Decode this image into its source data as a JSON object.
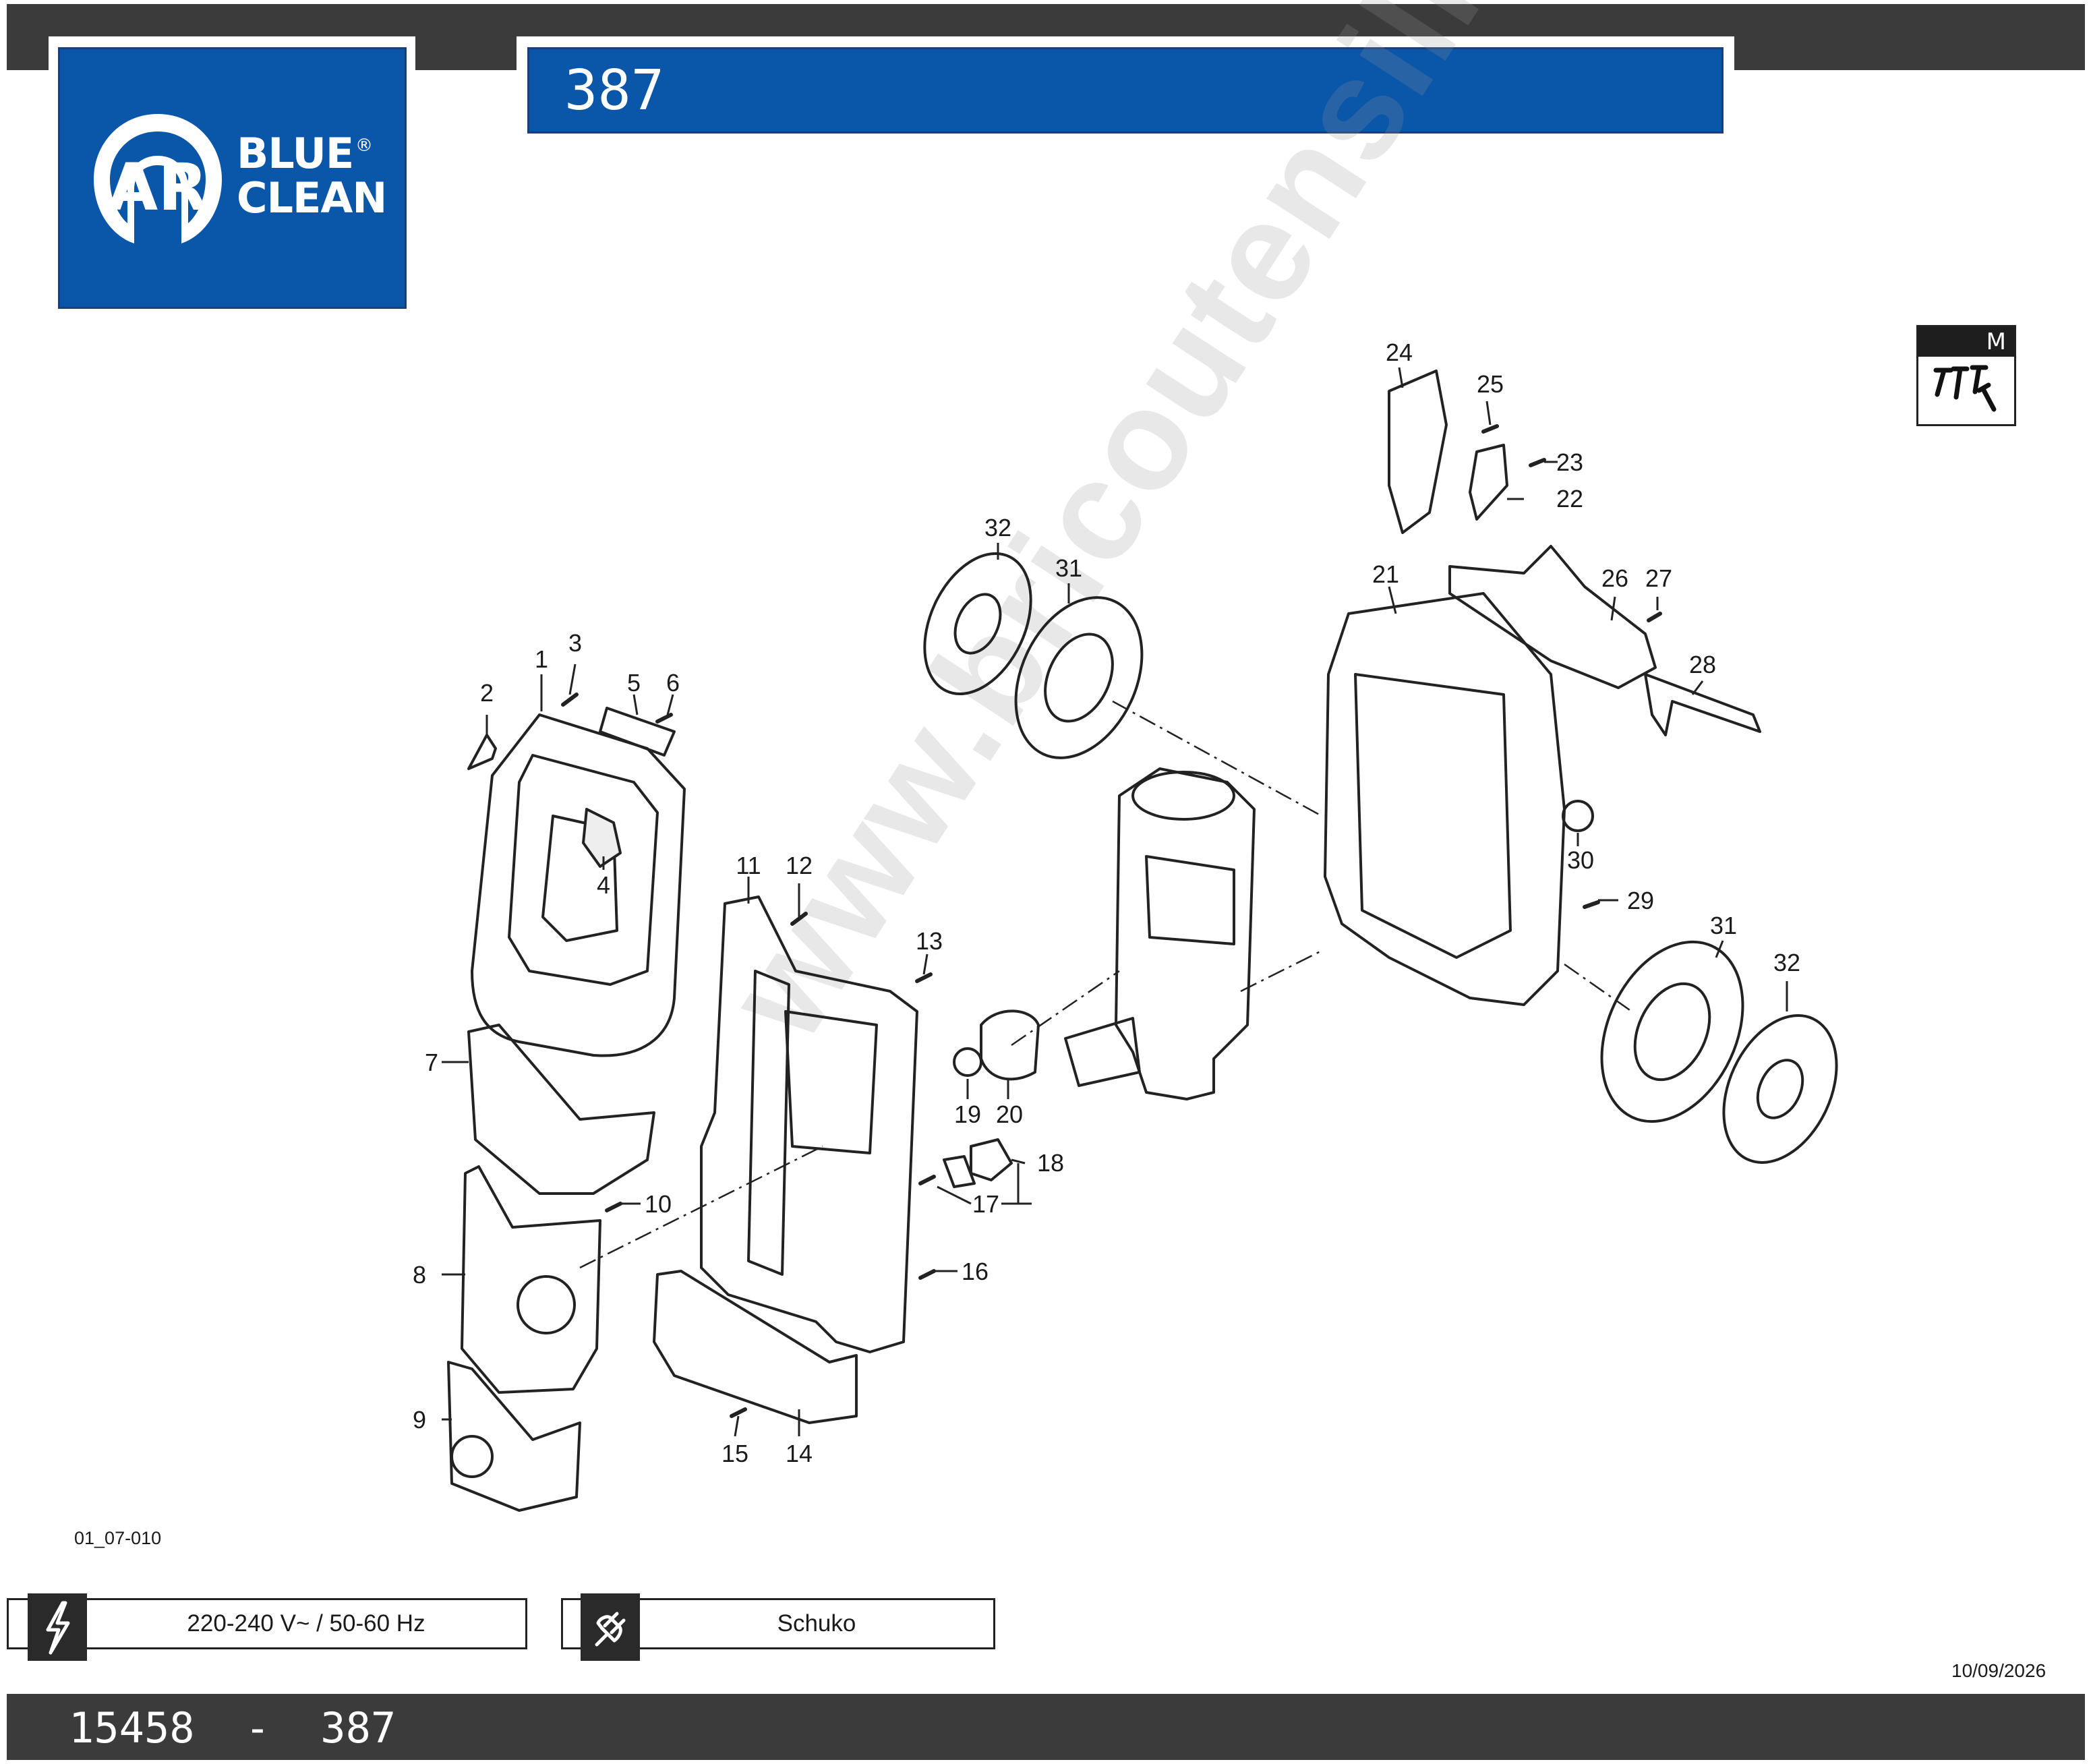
{
  "header": {
    "logo": {
      "mark": "AR",
      "line1": "BLUE",
      "line2": "CLEAN",
      "registered": "®"
    },
    "title": "387"
  },
  "kit_icon": {
    "letter": "M",
    "icon": "screws-kit-icon"
  },
  "diagram": {
    "watermark": "www.bricoutensili.com",
    "callouts": [
      "1",
      "2",
      "3",
      "4",
      "5",
      "6",
      "7",
      "8",
      "9",
      "10",
      "11",
      "12",
      "13",
      "14",
      "15",
      "16",
      "17",
      "18",
      "19",
      "20",
      "21",
      "22",
      "23",
      "24",
      "25",
      "26",
      "27",
      "28",
      "29",
      "30",
      "31",
      "32",
      "31",
      "32"
    ]
  },
  "drawing_code": "01_07-010",
  "specs": {
    "power": {
      "icon": "lightning-icon",
      "text": "220-240 V~ / 50-60 Hz"
    },
    "plug": {
      "icon": "plug-icon",
      "text": "Schuko"
    }
  },
  "date": "10/09/2026",
  "footer": {
    "text": "15458  -  387"
  }
}
